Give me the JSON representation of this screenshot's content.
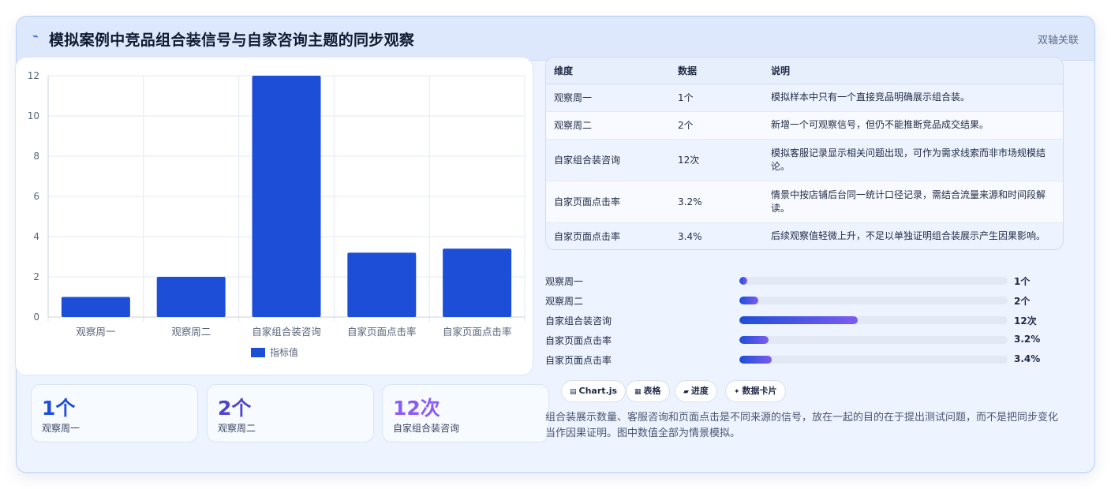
{
  "header": {
    "icon": "chart-line-icon",
    "title": "模拟案例中竞品组合装信号与自家咨询主题的同步观察",
    "tag": "双轴关联"
  },
  "chart_data": {
    "type": "bar",
    "categories": [
      "观察周一",
      "观察周二",
      "自家组合装咨询",
      "自家页面点击率",
      "自家页面点击率"
    ],
    "series": [
      {
        "name": "指标值",
        "values": [
          1,
          2,
          12,
          3.2,
          3.4
        ]
      }
    ],
    "ylim": [
      0,
      12
    ],
    "yticks": [
      0,
      2,
      4,
      6,
      8,
      10,
      12
    ],
    "legend_position": "bottom",
    "grid": true,
    "bar_color": "#1d4ed8"
  },
  "stats": [
    {
      "value": "1个",
      "label": "观察周一",
      "color": "#1d4ed8"
    },
    {
      "value": "2个",
      "label": "观察周二",
      "color": "#4f46c8"
    },
    {
      "value": "12次",
      "label": "自家组合装咨询",
      "color": "#8b5cf6"
    }
  ],
  "table": {
    "headers": [
      "维度",
      "数据",
      "说明"
    ],
    "rows": [
      [
        "观察周一",
        "1个",
        "模拟样本中只有一个直接竞品明确展示组合装。"
      ],
      [
        "观察周二",
        "2个",
        "新增一个可观察信号，但仍不能推断竞品成交结果。"
      ],
      [
        "自家组合装咨询",
        "12次",
        "模拟客服记录显示相关问题出现，可作为需求线索而非市场规模结论。"
      ],
      [
        "自家页面点击率",
        "3.2%",
        "情景中按店铺后台同一统计口径记录，需结合流量来源和时间段解读。"
      ],
      [
        "自家页面点击率",
        "3.4%",
        "后续观察值轻微上升，不足以单独证明组合装展示产生因果影响。"
      ]
    ]
  },
  "progress": [
    {
      "label": "观察周一",
      "value": "1个",
      "fraction": 0.03
    },
    {
      "label": "观察周二",
      "value": "2个",
      "fraction": 0.07
    },
    {
      "label": "自家组合装咨询",
      "value": "12次",
      "fraction": 0.44
    },
    {
      "label": "自家页面点击率",
      "value": "3.2%",
      "fraction": 0.11
    },
    {
      "label": "自家页面点击率",
      "value": "3.4%",
      "fraction": 0.12
    }
  ],
  "chips": [
    {
      "icon": "chart-icon",
      "glyph": "▤",
      "label": "Chart.js"
    },
    {
      "icon": "table-icon",
      "glyph": "▦",
      "label": "表格"
    },
    {
      "icon": "progress-icon",
      "glyph": "▰",
      "label": "进度"
    },
    {
      "icon": "sparkle-icon",
      "glyph": "✦",
      "label": "数据卡片"
    }
  ],
  "description": "组合装展示数量、客服咨询和页面点击是不同来源的信号，放在一起的目的在于提出测试问题，而不是把同步变化当作因果证明。图中数值全部为情景模拟。"
}
